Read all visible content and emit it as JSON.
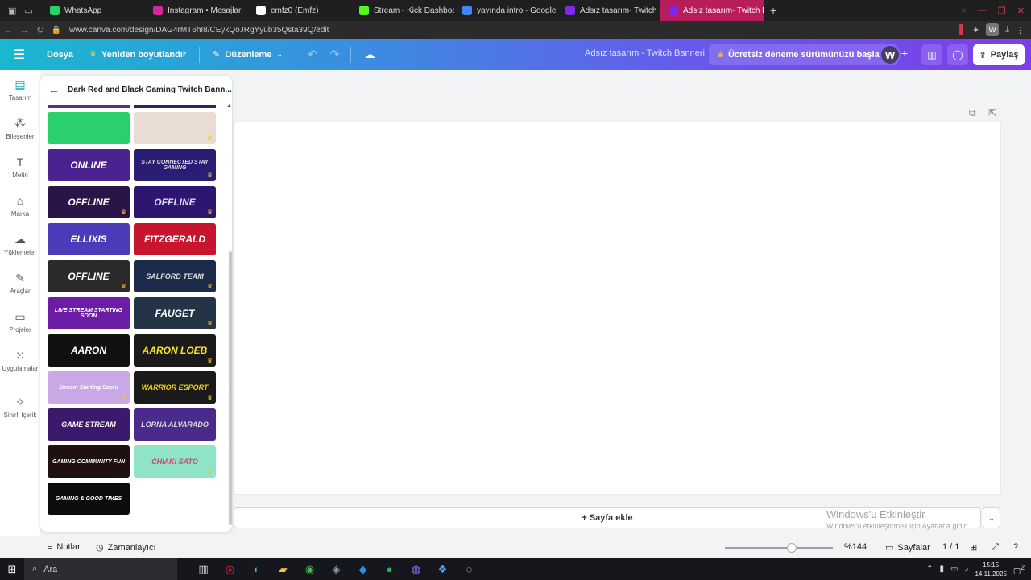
{
  "browser": {
    "tabs": [
      {
        "label": "WhatsApp",
        "color": "#25d366"
      },
      {
        "label": "Instagram • Mesajlar",
        "color": "#d6249f"
      },
      {
        "label": "emfz0 (Emfz)",
        "color": "#ffffff"
      },
      {
        "label": "Stream - Kick Dashboard",
        "color": "#53fc18"
      },
      {
        "label": "yayında intro - Google'da",
        "color": "#4285f4"
      },
      {
        "label": "Adsız tasarım- Twitch Ban",
        "color": "#7d2ae8"
      },
      {
        "label": "Adsız tasarım- Twitch Ban",
        "color": "#7d2ae8"
      }
    ],
    "url": "www.canva.com/design/DAG4rMT6hI8/CEykQoJRgYyub35Qsta39Q/edit",
    "profile_letter": "W"
  },
  "canva_top": {
    "file_label": "Dosya",
    "resize_label": "Yeniden boyutlandır",
    "edit_label": "Düzenleme",
    "design_title": "Adsız tasarım - Twitch Banneri",
    "trial_label": "Ücretsiz deneme sürümünüzü başlatın",
    "avatar_letter": "W",
    "share_label": "Paylaş"
  },
  "rail": {
    "items": [
      {
        "label": "Tasarım",
        "icon": "design-icon"
      },
      {
        "label": "Bileşenler",
        "icon": "elements-icon"
      },
      {
        "label": "Metin",
        "icon": "text-icon"
      },
      {
        "label": "Marka",
        "icon": "brand-icon"
      },
      {
        "label": "Yüklemeler",
        "icon": "upload-icon"
      },
      {
        "label": "Araçlar",
        "icon": "tools-icon"
      },
      {
        "label": "Projeler",
        "icon": "folder-icon"
      },
      {
        "label": "Uygulamalar",
        "icon": "apps-icon"
      },
      {
        "label": "Sihirli İçerik",
        "icon": "magic-icon"
      }
    ]
  },
  "panel": {
    "title": "Dark Red and Black Gaming Twitch Bann..."
  },
  "templates": [
    {
      "text": "",
      "bg": "#2ad06b",
      "color": "#111111"
    },
    {
      "text": "",
      "bg": "#e9dcd3",
      "color": "#b0203a",
      "premium": true
    },
    {
      "text": "ONLINE",
      "bg": "#4a2390",
      "color": "#ffffff"
    },
    {
      "text": "STAY CONNECTED STAY GAMING",
      "bg": "#2a1d74",
      "color": "#dddddd",
      "premium": true
    },
    {
      "text": "OFFLINE",
      "bg": "#2b1548",
      "color": "#ffffff",
      "premium": true
    },
    {
      "text": "OFFLINE",
      "bg": "#2e1670",
      "color": "#d8d8ff",
      "premium": true
    },
    {
      "text": "ELLIXIS",
      "bg": "#4c3bb8",
      "color": "#ffffff"
    },
    {
      "text": "FITZGERALD",
      "bg": "#c8152e",
      "color": "#ffffff"
    },
    {
      "text": "OFFLINE",
      "bg": "#2a2a2a",
      "color": "#ffffff",
      "premium": true
    },
    {
      "text": "SALFORD TEAM",
      "bg": "#1d2b4a",
      "color": "#dddddd",
      "premium": true
    },
    {
      "text": "LIVE STREAM STARTING SOON",
      "bg": "#6c1da6",
      "color": "#ffffff"
    },
    {
      "text": "FAUGET",
      "bg": "#243447",
      "color": "#ffffff",
      "premium": true
    },
    {
      "text": "AARON",
      "bg": "#111111",
      "color": "#ffffff"
    },
    {
      "text": "AARON LOEB",
      "bg": "#1a1a1a",
      "color": "#f5e52a",
      "premium": true
    },
    {
      "text": "Stream Starting Soon!",
      "bg": "#c9a8e6",
      "color": "#ffffff",
      "premium": true
    },
    {
      "text": "WARRIOR ESPORT",
      "bg": "#1a1a1a",
      "color": "#f1d21b",
      "premium": true
    },
    {
      "text": "GAME STREAM",
      "bg": "#3b1a6e",
      "color": "#ffffff"
    },
    {
      "text": "LORNA ALVARADO",
      "bg": "#4a2a8a",
      "color": "#dddddd"
    },
    {
      "text": "GAMING COMMUNITY FUN",
      "bg": "#201010",
      "color": "#ffffff"
    },
    {
      "text": "CHIAKI SATO",
      "bg": "#8fe3c6",
      "color": "#d63b7d",
      "premium": true
    },
    {
      "text": "GAMING & GOOD TIMES",
      "bg": "#0c0c0c",
      "color": "#ffffff"
    }
  ],
  "workspace": {
    "add_page_label": "+ Sayfa ekle",
    "watermark_title": "Windows'u Etkinleştir",
    "watermark_sub": "Windows'u etkinleştirmek için Ayarlar'a gidin."
  },
  "footer": {
    "notes_label": "Notlar",
    "timer_label": "Zamanlayıcı",
    "zoom_percent": "%144",
    "zoom_level": 0.62,
    "pages_label": "Sayfalar",
    "page_count": "1 / 1"
  },
  "taskbar": {
    "search_label": "Ara",
    "time": "15:15",
    "date": "14.11.2025",
    "notification_count": "2"
  }
}
